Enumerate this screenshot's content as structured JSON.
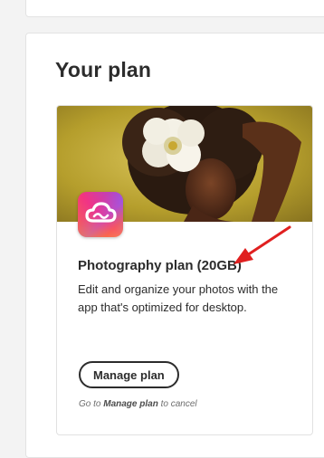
{
  "section": {
    "title": "Your plan"
  },
  "plan": {
    "name": "Photography plan (20GB)",
    "description": "Edit and organize your photos with the app that's optimized for desktop.",
    "manage_label": "Manage plan",
    "cancel_note_prefix": "Go to ",
    "cancel_note_link": "Manage plan",
    "cancel_note_suffix": " to cancel",
    "app_icon": "creative-cloud-icon"
  },
  "colors": {
    "annotation": "#e02020",
    "hero_background": "#c7b13a",
    "text": "#2c2c2c"
  }
}
